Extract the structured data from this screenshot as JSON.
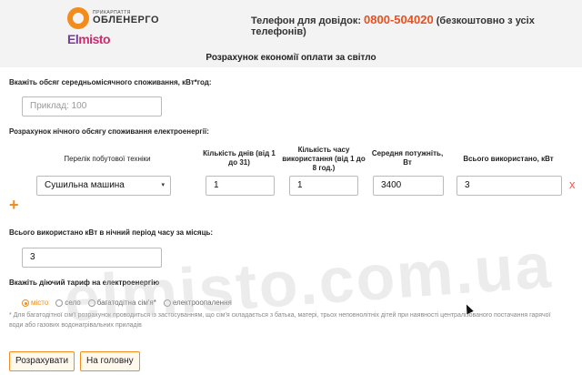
{
  "header": {
    "logo_small": "ПРИКАРПАТТЯ",
    "logo_big": "ОБЛЕНЕРГО",
    "phone_label": "Телефон для довідок:",
    "phone_number": "0800-504020",
    "phone_note": "(безкоштовно з усіх телефонів)",
    "elmisto_prefix": "El",
    "elmisto_suffix": "misto"
  },
  "page_title": "Розрахунок економії оплати за світло",
  "avg_section": {
    "label": "Вкажіть обсяг середньомісячного споживання, кВт*год:",
    "placeholder": "Приклад: 100",
    "value": ""
  },
  "night_section": {
    "label": "Розрахунок нічного обсягу споживання електроенергії:",
    "columns": {
      "appliance": "Перелік побутової техніки",
      "days": "Кількість днів (від 1 до 31)",
      "hours": "Кількість часу використання (від 1 до 8 год.)",
      "power": "Середня потужніть, Вт",
      "total": "Всього використано, кВт"
    },
    "row": {
      "appliance": "Сушильна машина",
      "days": "1",
      "hours": "1",
      "power": "3400",
      "total": "3"
    },
    "add_symbol": "+",
    "remove_symbol": "x"
  },
  "night_total": {
    "label": "Всього використано кВт в нічний період часу за місяць:",
    "value": "3"
  },
  "tariff": {
    "label": "Вкажіть діючий тариф на електроенергію",
    "options": [
      "місто",
      "село",
      "багатодітна сім'я*",
      "електроопалення"
    ],
    "selected_index": 0,
    "note": "* Для багатодітної сім'ї розрахунок проводиться із застосуванням, що сім'я складається з батька, матері, трьох неповнолітніх дітей при наявності централізованого постачання гарячої води або газових водонагрівальних приладів"
  },
  "buttons": {
    "calculate": "Розрахувати",
    "home": "На головну"
  },
  "watermark": "elmisto.com.ua"
}
